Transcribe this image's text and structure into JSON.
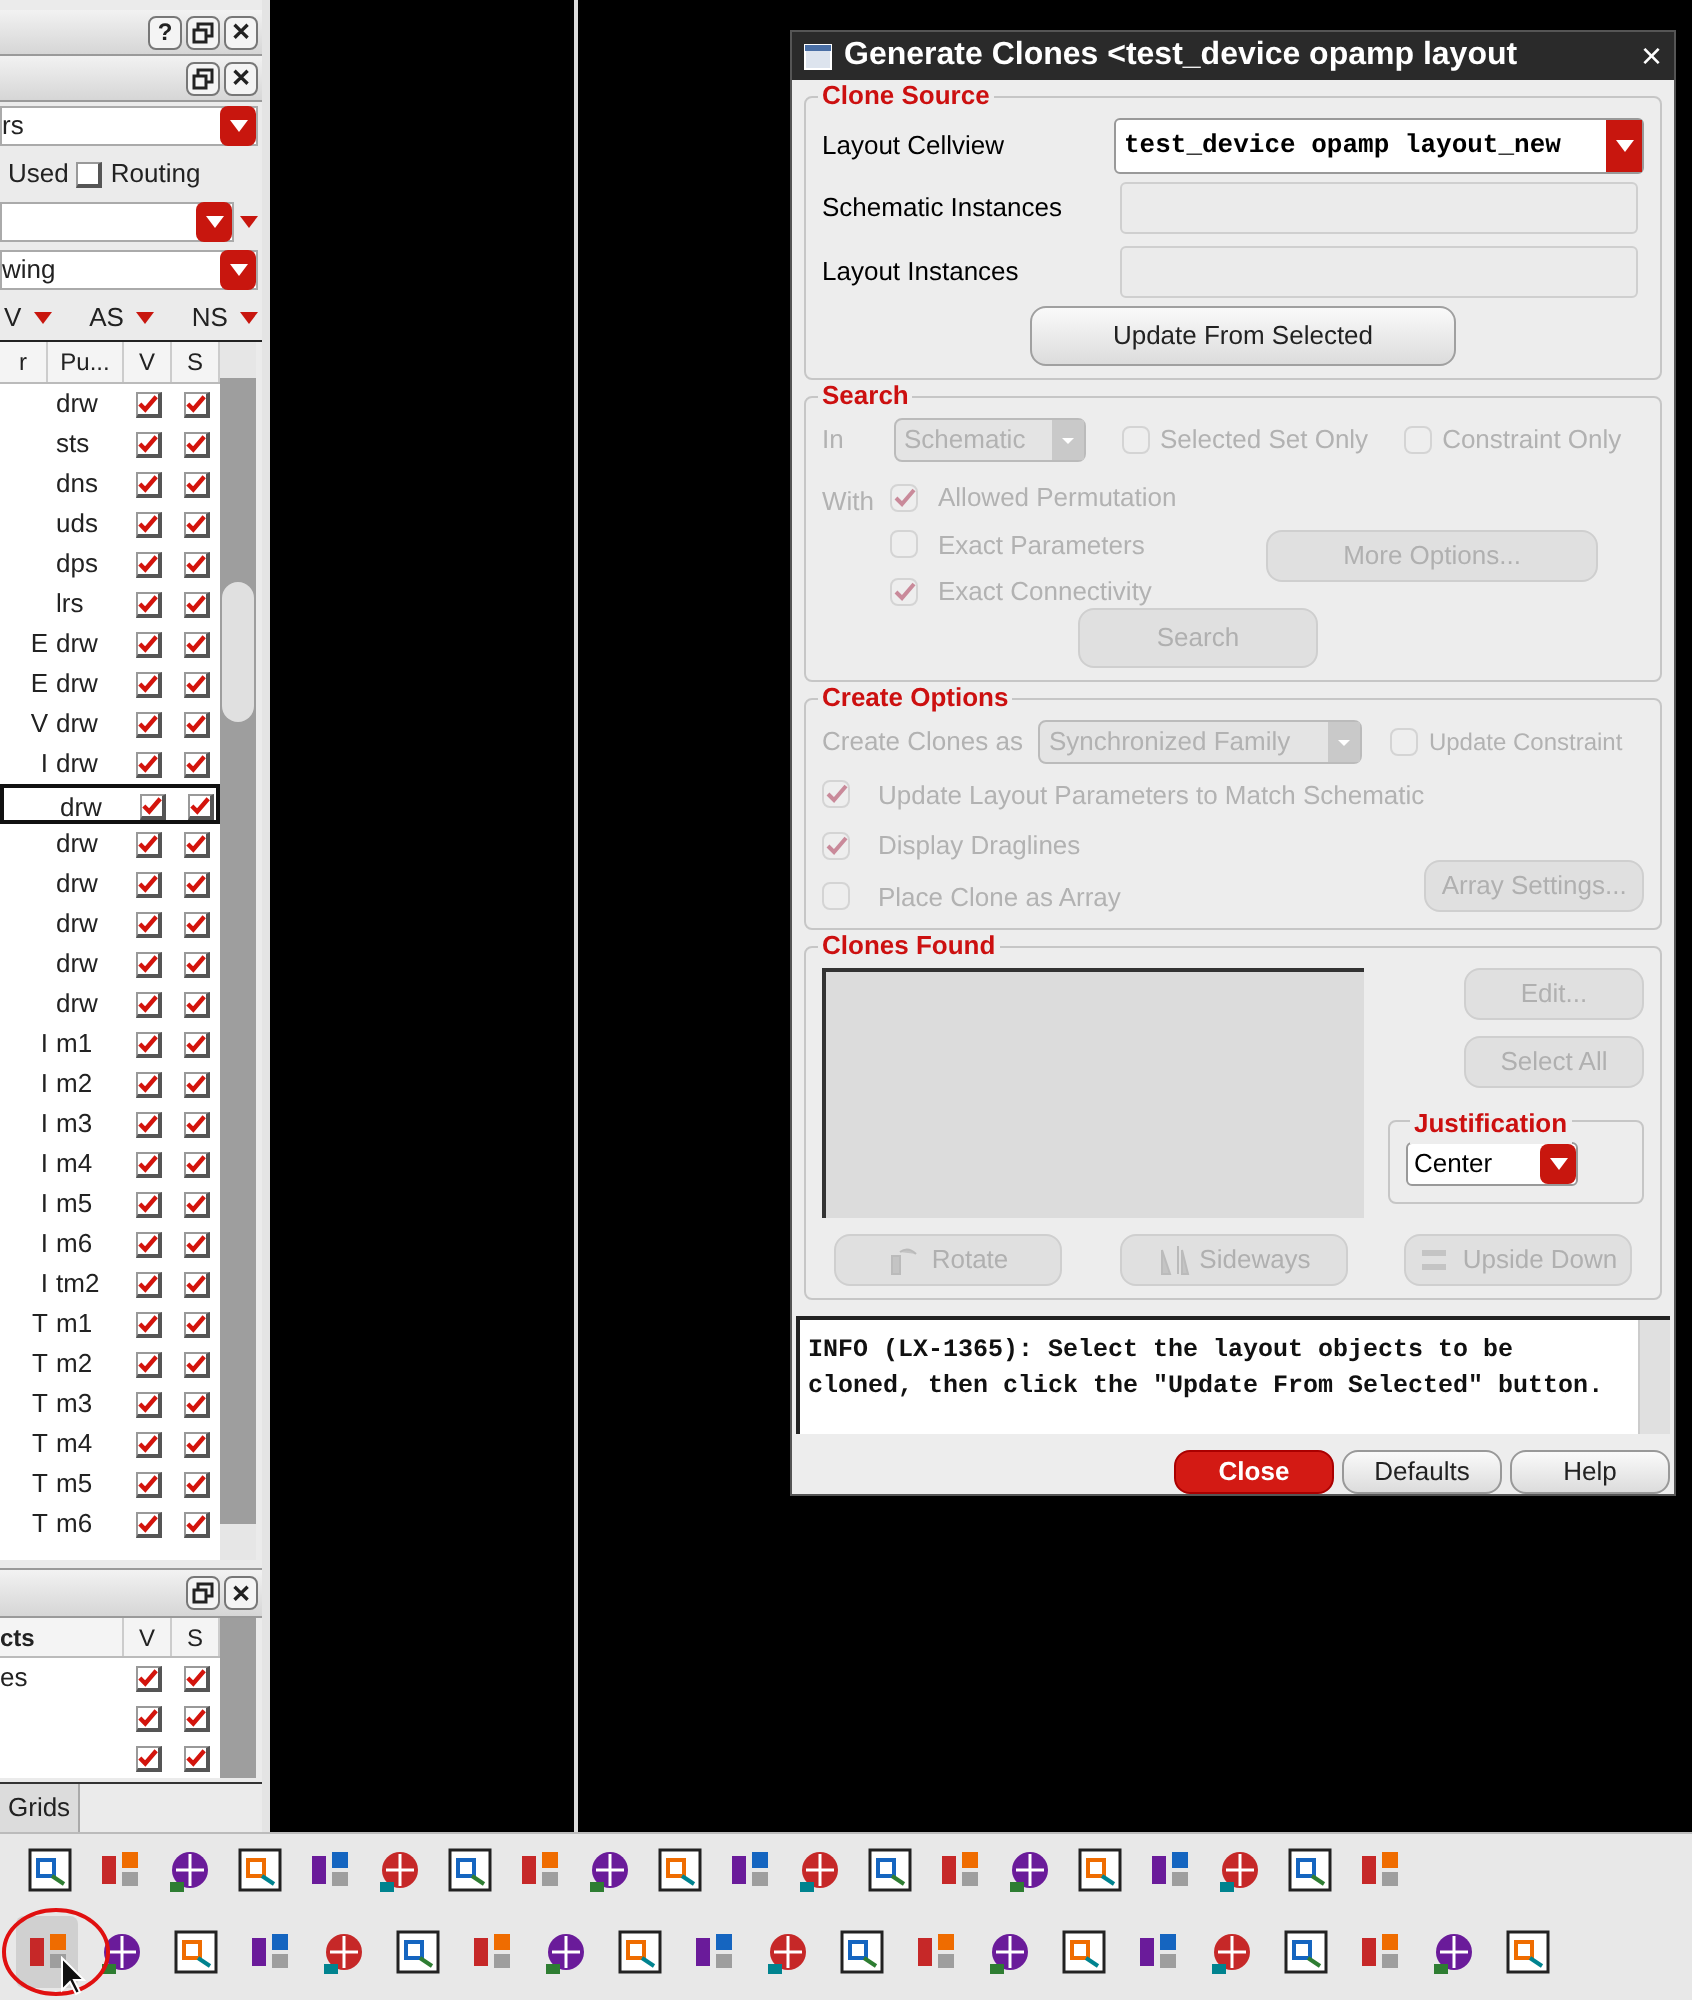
{
  "layers_panel": {
    "header_buttons": [
      {
        "kind": "help",
        "label": "?"
      },
      {
        "kind": "restore"
      },
      {
        "kind": "close",
        "label": "✕"
      }
    ],
    "sub_header_buttons": [
      {
        "kind": "restore"
      },
      {
        "kind": "close",
        "label": "✕"
      }
    ],
    "filter_dropdown": {
      "value": "rs"
    },
    "used_label": "Used",
    "routing_checkbox": {
      "label": "Routing",
      "checked": false
    },
    "view_dropdown": {
      "value": "wing"
    },
    "filter_toggles": [
      "V",
      "AS",
      "NS"
    ],
    "table": {
      "columns": [
        "r",
        "Pu...",
        "V",
        "S"
      ],
      "rows": [
        {
          "purpose": "drw",
          "visible": true,
          "selectable": true,
          "selected": false
        },
        {
          "purpose": "sts",
          "visible": true,
          "selectable": true,
          "selected": false
        },
        {
          "purpose": "dns",
          "visible": true,
          "selectable": true,
          "selected": false
        },
        {
          "purpose": "uds",
          "visible": true,
          "selectable": true,
          "selected": false
        },
        {
          "purpose": "dps",
          "visible": true,
          "selectable": true,
          "selected": false
        },
        {
          "purpose": "lrs",
          "visible": true,
          "selectable": true,
          "selected": false
        },
        {
          "name": "E",
          "purpose": "drw",
          "visible": true,
          "selectable": true,
          "selected": false
        },
        {
          "name": "E",
          "purpose": "drw",
          "visible": true,
          "selectable": true,
          "selected": false
        },
        {
          "name": "V",
          "purpose": "drw",
          "visible": true,
          "selectable": true,
          "selected": false
        },
        {
          "name": "I",
          "purpose": "drw",
          "visible": true,
          "selectable": true,
          "selected": false
        },
        {
          "purpose": "drw",
          "visible": true,
          "selectable": true,
          "selected": true
        },
        {
          "purpose": "drw",
          "visible": true,
          "selectable": true,
          "selected": false
        },
        {
          "purpose": "drw",
          "visible": true,
          "selectable": true,
          "selected": false
        },
        {
          "purpose": "drw",
          "visible": true,
          "selectable": true,
          "selected": false
        },
        {
          "purpose": "drw",
          "visible": true,
          "selectable": true,
          "selected": false
        },
        {
          "purpose": "drw",
          "visible": true,
          "selectable": true,
          "selected": false
        },
        {
          "name": "I",
          "purpose": "m1",
          "visible": true,
          "selectable": true,
          "selected": false
        },
        {
          "name": "I",
          "purpose": "m2",
          "visible": true,
          "selectable": true,
          "selected": false
        },
        {
          "name": "I",
          "purpose": "m3",
          "visible": true,
          "selectable": true,
          "selected": false
        },
        {
          "name": "I",
          "purpose": "m4",
          "visible": true,
          "selectable": true,
          "selected": false
        },
        {
          "name": "I",
          "purpose": "m5",
          "visible": true,
          "selectable": true,
          "selected": false
        },
        {
          "name": "I",
          "purpose": "m6",
          "visible": true,
          "selectable": true,
          "selected": false
        },
        {
          "name": "I",
          "purpose": "tm2",
          "visible": true,
          "selectable": true,
          "selected": false
        },
        {
          "name": "T",
          "purpose": "m1",
          "visible": true,
          "selectable": true,
          "selected": false
        },
        {
          "name": "T",
          "purpose": "m2",
          "visible": true,
          "selectable": true,
          "selected": false
        },
        {
          "name": "T",
          "purpose": "m3",
          "visible": true,
          "selectable": true,
          "selected": false
        },
        {
          "name": "T",
          "purpose": "m4",
          "visible": true,
          "selectable": true,
          "selected": false
        },
        {
          "name": "T",
          "purpose": "m5",
          "visible": true,
          "selectable": true,
          "selected": false
        },
        {
          "name": "T",
          "purpose": "m6",
          "visible": true,
          "selectable": true,
          "selected": false
        }
      ]
    }
  },
  "objects_panel": {
    "header_buttons": [
      {
        "kind": "restore"
      },
      {
        "kind": "close",
        "label": "✕"
      }
    ],
    "columns": [
      "cts",
      "V",
      "S"
    ],
    "rows": [
      {
        "name": "es",
        "visible": true,
        "selectable": true
      },
      {
        "visible": true,
        "selectable": true
      },
      {
        "visible": true,
        "selectable": true
      }
    ]
  },
  "tabs": [
    {
      "label": "Grids",
      "selected": true
    }
  ],
  "dialog": {
    "title": "Generate Clones <test_device opamp layout",
    "close_label": "×",
    "clone_source": {
      "title": "Clone Source",
      "layout_cellview_label": "Layout Cellview",
      "layout_cellview_value": "test_device opamp layout_new",
      "schematic_instances_label": "Schematic Instances",
      "layout_instances_label": "Layout Instances",
      "update_button": "Update From Selected"
    },
    "search": {
      "title": "Search",
      "disabled": true,
      "in_label": "In",
      "in_value": "Schematic",
      "with_label": "With",
      "options": [
        {
          "label": "Selected Set Only",
          "checked": false
        },
        {
          "label": "Constraint Only",
          "checked": false
        },
        {
          "label": "Allowed Permutation",
          "checked": true
        },
        {
          "label": "Exact Parameters",
          "checked": false
        },
        {
          "label": "Exact Connectivity",
          "checked": true
        }
      ],
      "more_options_button": "More Options...",
      "search_button": "Search"
    },
    "create_options": {
      "title": "Create Options",
      "disabled": true,
      "create_as_label": "Create Clones as",
      "create_as_value": "Synchronized Family",
      "options": [
        {
          "label": "Update Constraint",
          "checked": false
        },
        {
          "label": "Update Layout Parameters to Match Schematic",
          "checked": true
        },
        {
          "label": "Display Draglines",
          "checked": true
        },
        {
          "label": "Place Clone as Array",
          "checked": false
        }
      ],
      "array_settings_button": "Array Settings..."
    },
    "clones_found": {
      "title": "Clones Found",
      "buttons": [
        {
          "label": "Edit...",
          "disabled": true
        },
        {
          "label": "Select All",
          "disabled": true
        }
      ],
      "justification": {
        "title": "Justification",
        "value": "Center"
      },
      "transform_buttons": [
        {
          "kind": "rotate",
          "label": "Rotate",
          "disabled": true
        },
        {
          "kind": "sideways",
          "label": "Sideways",
          "disabled": true
        },
        {
          "kind": "upside_down",
          "label": "Upside Down",
          "disabled": true
        }
      ]
    },
    "message": "INFO (LX-1365): Select the layout objects to be cloned, then click the \"Update From Selected\" button.",
    "footer_buttons": [
      {
        "kind": "primary",
        "label": "Close"
      },
      {
        "kind": "normal",
        "label": "Defaults"
      },
      {
        "kind": "normal",
        "label": "Help"
      }
    ]
  }
}
